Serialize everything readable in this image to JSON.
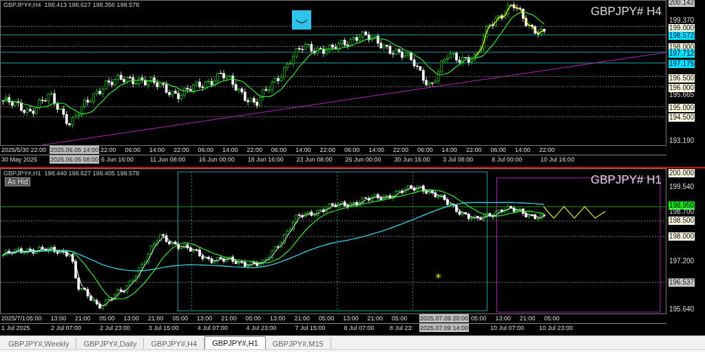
{
  "panes": [
    {
      "header": "GBPJPY#,H4  198.413 198.627 198.356 198.578",
      "title": "GBPJPY# H4",
      "price_labels": [
        {
          "text": "200.142",
          "kind": "current"
        },
        {
          "text": "199.370",
          "kind": "plain"
        },
        {
          "text": "199.000",
          "kind": "level"
        },
        {
          "text": "198.572",
          "kind": "line"
        },
        {
          "text": "198.000",
          "kind": "level"
        },
        {
          "text": "197.712",
          "kind": "line"
        },
        {
          "text": "197.175",
          "kind": "line"
        },
        {
          "text": "196.500",
          "kind": "level"
        },
        {
          "text": "196.000",
          "kind": "level"
        },
        {
          "text": "195.665",
          "kind": "plain"
        },
        {
          "text": "195.000",
          "kind": "level"
        },
        {
          "text": "194.500",
          "kind": "level"
        },
        {
          "text": "193.190",
          "kind": "plain"
        }
      ],
      "time_row_1": [
        "2025/5/30 22:00",
        "22:00",
        "06:00",
        "14:00",
        "22:00",
        "06:00",
        "14:00",
        "22:00",
        "06:00",
        "14:00",
        "22:00",
        "06:00",
        "14:00",
        "22:00",
        "06:00",
        "14:00",
        "22:00",
        "06:00",
        "14:00",
        "22:00"
      ],
      "cursor_time_1": "2025.06.05 14:00",
      "time_row_2": [
        "30 May 2025",
        "6 Jun 16:00",
        "11 Jun 08:00",
        "16 Jun 00:00",
        "18 Jun 16:00",
        "23 Jun 08:00",
        "26 Jun 00:00",
        "30 Jun 16:00",
        "3 Jul 08:00",
        "8 Jul 00:00",
        "10 Jul 16:00"
      ],
      "cursor_time_2": "2025.06.05 08:00"
    },
    {
      "header": "GBPJPY#,H1  198.440 198.627 198.405 198.578",
      "title": "GBPJPY# H1",
      "object_label": "As Hid",
      "price_labels": [
        {
          "text": "200.000",
          "kind": "level"
        },
        {
          "text": "199.540",
          "kind": "plain"
        },
        {
          "text": "198.950",
          "kind": "alert"
        },
        {
          "text": "198.700",
          "kind": "plain"
        },
        {
          "text": "198.500",
          "kind": "level"
        },
        {
          "text": "198.000",
          "kind": "level"
        },
        {
          "text": "197.200",
          "kind": "plain"
        },
        {
          "text": "196.537",
          "kind": "current"
        },
        {
          "text": "195.640",
          "kind": "plain"
        }
      ],
      "time_row_1": [
        "2025/7/1",
        "05:00",
        "13:00",
        "21:00",
        "05:00",
        "13:00",
        "21:00",
        "05:00",
        "13:00",
        "21:00",
        "05:00",
        "13:00",
        "21:00",
        "05:00",
        "13:00",
        "21:00",
        "05:00",
        "05:00",
        "13:00",
        "21:00",
        "05:00"
      ],
      "cursor_time_1": "2025.07.09 20:00",
      "time_row_2": [
        "1 Jul 2025",
        "2 Jul 07:00",
        "2 Jul 23:00",
        "3 Jul 15:00",
        "4 Jul 07:00",
        "4 Jul 23:00",
        "7 Jul 15:00",
        "8 Jul 07:00",
        "8 Jul 23:",
        "10 Jul 07:00",
        "10 Jul 23:00"
      ],
      "cursor_time_2": "2025.07.09 14:00"
    }
  ],
  "tabs": [
    {
      "label": "GBPJPY#,Weekly",
      "selected": false
    },
    {
      "label": "GBPJPY#,Daily",
      "selected": false
    },
    {
      "label": "GBPJPY#,H4",
      "selected": false
    },
    {
      "label": "GBPJPY#,H1",
      "selected": true
    },
    {
      "label": "GBPJPY#,M15",
      "selected": false
    }
  ]
}
